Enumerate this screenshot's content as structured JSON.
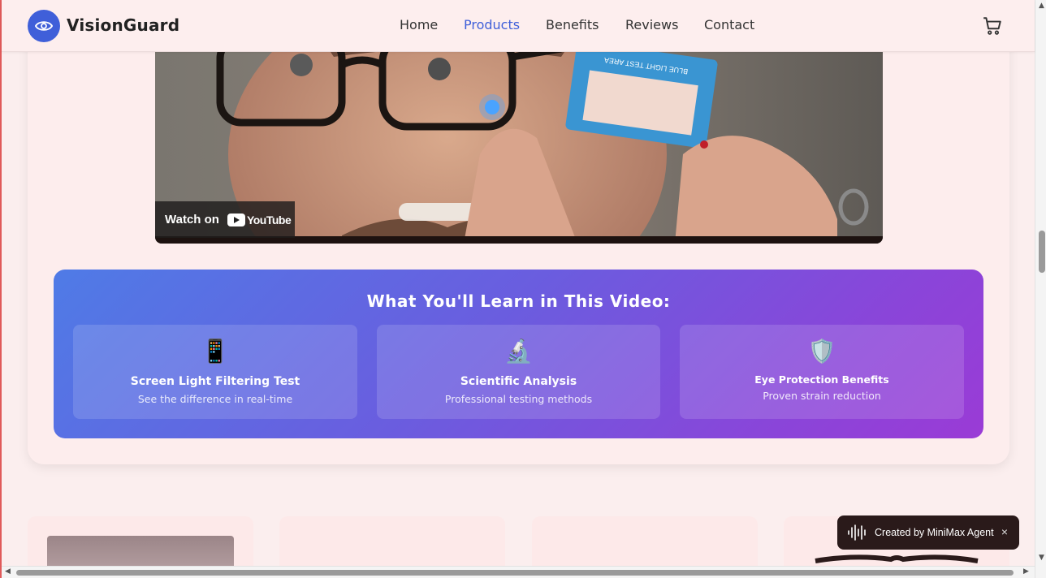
{
  "header": {
    "brand": "VisionGuard",
    "nav": [
      {
        "label": "Home",
        "active": false
      },
      {
        "label": "Products",
        "active": true
      },
      {
        "label": "Benefits",
        "active": false
      },
      {
        "label": "Reviews",
        "active": false
      },
      {
        "label": "Contact",
        "active": false
      }
    ],
    "cart_icon": "cart-icon",
    "logo_icon": "eye-icon",
    "accent": "#3f5fd9"
  },
  "video": {
    "watch_on": "Watch on",
    "youtube": "YouTube",
    "card_text": "BLUE LIGHT TEST AREA"
  },
  "learn": {
    "title": "What You'll Learn in This Video:",
    "items": [
      {
        "icon": "📱",
        "title": "Screen Light Filtering Test",
        "subtitle": "See the difference in real-time"
      },
      {
        "icon": "🔬",
        "title": "Scientific Analysis",
        "subtitle": "Professional testing methods"
      },
      {
        "icon": "🛡️",
        "title": "Eye Protection Benefits",
        "subtitle": "Proven strain reduction"
      }
    ]
  },
  "toast": {
    "label": "Created by MiniMax Agent",
    "close": "×"
  }
}
